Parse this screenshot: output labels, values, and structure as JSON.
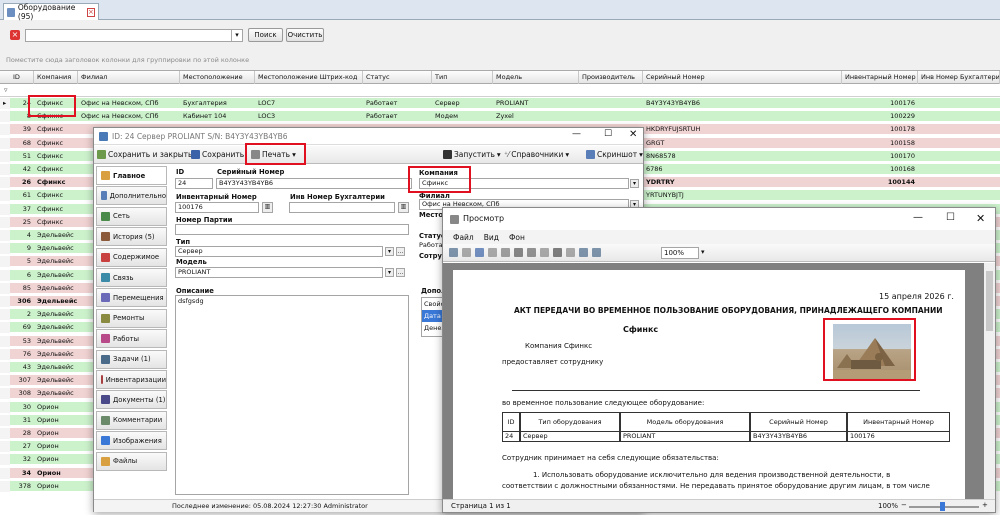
{
  "tab": {
    "title": "Оборудование (95)"
  },
  "toolbar": {
    "search_label": "Поиск",
    "clear_label": "Очистить",
    "group_hint": "Поместите сюда заголовок колонки для группировки по этой колонке"
  },
  "columns": [
    "ID",
    "Компания",
    "Филиал",
    "Местоположение",
    "Местоположение Штрих-код",
    "Статус",
    "Тип",
    "Модель",
    "Производитель",
    "Серийный Номер",
    "Инвентарный Номер",
    "Инв Номер Бухгалтерии"
  ],
  "grid_rows": [
    {
      "id": "24",
      "company": "Сфинкс",
      "branch": "Офис на Невском, СПб",
      "loc": "Бухгалтерия",
      "barcode": "LOC7",
      "status": "Работает",
      "type": "Сервер",
      "model": "PROLIANT",
      "serial": "B4Y3Y43YB4YB6",
      "inv": "100176",
      "color": "#ccf2cc",
      "bold": false,
      "selected": true
    },
    {
      "id": "8",
      "company": "Сфинкс",
      "branch": "Офис на Невском, СПб",
      "loc": "Кабинет 104",
      "barcode": "LOC3",
      "status": "Работает",
      "type": "Модем",
      "model": "Zyxel",
      "serial": "",
      "inv": "100229",
      "color": "#ccf2cc",
      "bold": false
    },
    {
      "id": "39",
      "company": "Сфинкс",
      "serial": "HKDRYFUJSRTUH",
      "inv": "100178",
      "color": "#f0d3d3",
      "bold": false
    },
    {
      "id": "68",
      "company": "Сфинкс",
      "serial": "GRGT",
      "inv": "100158",
      "color": "#f0d3d3",
      "bold": false
    },
    {
      "id": "51",
      "company": "Сфинкс",
      "serial": "8N68578",
      "inv": "100170",
      "color": "#ccf2cc",
      "bold": false
    },
    {
      "id": "42",
      "company": "Сфинкс",
      "serial": "6786",
      "inv": "100168",
      "color": "#ccf2cc",
      "bold": false
    },
    {
      "id": "26",
      "company": "Сфинкс",
      "serial": "YDRTRY",
      "inv": "100144",
      "color": "#f0d3d3",
      "bold": true
    },
    {
      "id": "61",
      "company": "Сфинкс",
      "serial": "YRTUNYBJTJ",
      "inv": "",
      "color": "#ccf2cc",
      "bold": false
    },
    {
      "id": "37",
      "company": "Сфинкс",
      "serial": "",
      "inv": "",
      "color": "#ccf2cc",
      "bold": false
    },
    {
      "id": "25",
      "company": "Сфинкс",
      "serial": "",
      "inv": "",
      "color": "#f0d3d3",
      "bold": false
    },
    {
      "id": "4",
      "company": "Эдельвейс",
      "serial": "",
      "inv": "",
      "color": "#ccf2cc",
      "bold": false
    },
    {
      "id": "9",
      "company": "Эдельвейс",
      "serial": "",
      "inv": "",
      "color": "#ccf2cc",
      "bold": false
    },
    {
      "id": "5",
      "company": "Эдельвейс",
      "serial": "",
      "inv": "",
      "color": "#f0d3d3",
      "bold": false
    },
    {
      "id": "6",
      "company": "Эдельвейс",
      "serial": "",
      "inv": "",
      "color": "#ccf2cc",
      "bold": false
    },
    {
      "id": "85",
      "company": "Эдельвейс",
      "serial": "",
      "inv": "",
      "color": "#f0d3d3",
      "bold": false
    },
    {
      "id": "306",
      "company": "Эдельвейс",
      "serial": "",
      "inv": "",
      "color": "#f0d3d3",
      "bold": true
    },
    {
      "id": "2",
      "company": "Эдельвейс",
      "serial": "",
      "inv": "",
      "color": "#ccf2cc",
      "bold": false
    },
    {
      "id": "69",
      "company": "Эдельвейс",
      "serial": "",
      "inv": "",
      "color": "#ccf2cc",
      "bold": false
    },
    {
      "id": "53",
      "company": "Эдельвейс",
      "serial": "",
      "inv": "",
      "color": "#f0d3d3",
      "bold": false
    },
    {
      "id": "76",
      "company": "Эдельвейс",
      "serial": "",
      "inv": "",
      "color": "#f0d3d3",
      "bold": false
    },
    {
      "id": "43",
      "company": "Эдельвейс",
      "serial": "",
      "inv": "",
      "color": "#ccf2cc",
      "bold": false
    },
    {
      "id": "307",
      "company": "Эдельвейс",
      "serial": "",
      "inv": "",
      "color": "#f0d3d3",
      "bold": false
    },
    {
      "id": "308",
      "company": "Эдельвейс",
      "serial": "",
      "inv": "",
      "color": "#f0d3d3",
      "bold": false
    },
    {
      "id": "30",
      "company": "Орион",
      "serial": "",
      "inv": "",
      "color": "#ccf2cc",
      "bold": false
    },
    {
      "id": "31",
      "company": "Орион",
      "serial": "",
      "inv": "",
      "color": "#ccf2cc",
      "bold": false
    },
    {
      "id": "28",
      "company": "Орион",
      "serial": "",
      "inv": "",
      "color": "#f0d3d3",
      "bold": false
    },
    {
      "id": "27",
      "company": "Орион",
      "serial": "",
      "inv": "",
      "color": "#ccf2cc",
      "bold": false
    },
    {
      "id": "32",
      "company": "Орион",
      "serial": "",
      "inv": "",
      "color": "#ccf2cc",
      "bold": false
    },
    {
      "id": "34",
      "company": "Орион",
      "serial": "",
      "inv": "",
      "color": "#f0d3d3",
      "bold": true
    },
    {
      "id": "378",
      "company": "Орион",
      "serial": "",
      "inv": "",
      "color": "#ccf2cc",
      "bold": false
    }
  ],
  "editor": {
    "title": "ID: 24 Сервер PROLIANT S/N: B4Y3Y43YB4YB6",
    "save_close": "Сохранить и закрыть",
    "save": "Сохранить",
    "print": "Печать",
    "run": "Запустить",
    "refs": "Справочники",
    "screenshot": "Скриншот",
    "nav": [
      "Главное",
      "Дополнительно",
      "Сеть",
      "История (5)",
      "Содержимое",
      "Связь",
      "Перемещения",
      "Ремонты",
      "Работы",
      "Задачи (1)",
      "Инвентаризации",
      "Документы (1)",
      "Комментарии",
      "Изображения",
      "Файлы"
    ],
    "id_label": "ID",
    "id_value": "24",
    "serial_label": "Серийный Номер",
    "serial_value": "B4Y3Y43YB4YB6",
    "company_label": "Компания",
    "company_value": "Сфинкс",
    "inv_label": "Инвентарный Номер",
    "inv_value": "100176",
    "acc_label": "Инв Номер Бухгалтерии",
    "branch_label": "Филиал",
    "branch_value": "Офис на Невском, СПб",
    "party_label": "Номер Партии",
    "loc_label": "Место",
    "status_label": "Статус",
    "status_value": "Работа",
    "emp_label": "Сотру",
    "type_label": "Тип",
    "type_value": "Сервер",
    "model_label": "Модель",
    "model_value": "PROLIANT",
    "desc_label": "Описание",
    "desc_value": "dsfgsdg",
    "extra_label": "Допол",
    "extra_items": [
      "Свойс",
      "Дата п",
      "Денеж"
    ],
    "footer": "Последнее изменение: 05.08.2024 12:27:30   Administrator"
  },
  "preview": {
    "title": "Просмотр",
    "menu": [
      "Файл",
      "Вид",
      "Фон"
    ],
    "zoom": "100%",
    "date": "15 апреля 2026 г.",
    "heading": "АКТ ПЕРЕДАЧИ ВО ВРЕМЕННОЕ ПОЛЬЗОВАНИЕ ОБОРУДОВАНИЯ, ПРИНАДЛЕЖАЩЕГО КОМПАНИИ",
    "company_name": "Сфинкс",
    "company_line": "Компания   Сфинкс",
    "provides": "предоставляет сотруднику",
    "temp_use": "во временное пользование следующее оборудование:",
    "table_headers": [
      "ID",
      "Тип оборудования",
      "Модель оборудования",
      "Серийный Номер",
      "Инвентарный Номер"
    ],
    "table_row": [
      "24",
      "Сервер",
      "PROLIANT",
      "B4Y3Y43YB4YB6",
      "100176"
    ],
    "obligations": "Сотрудник принимает на себя следующие обязательства:",
    "item1": "1. Использовать оборудование исключительно для ведения производственной деятельности, в",
    "item1b": "соответствии с должностными обязанностями. Не передавать принятое оборудование другим лицам, в том числе",
    "page_status": "Страница 1 из 1",
    "zoom_status": "100%"
  }
}
